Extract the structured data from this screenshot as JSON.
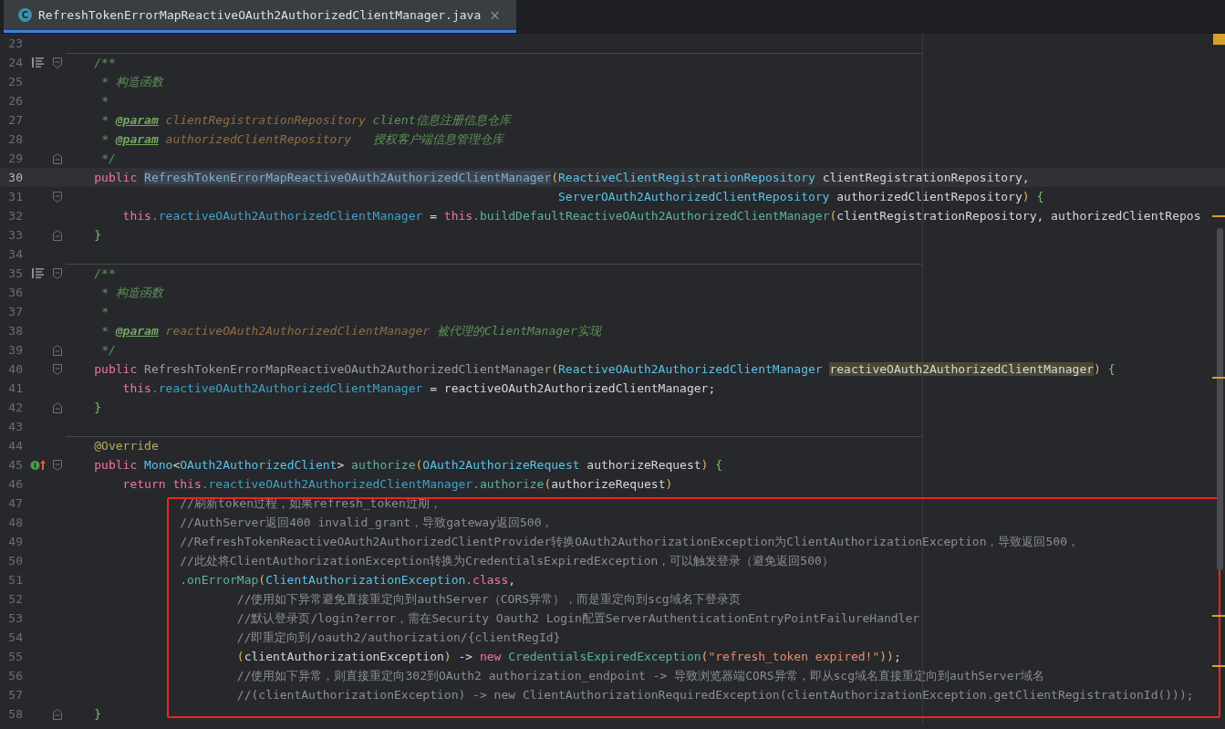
{
  "tab": {
    "icon_letter": "C",
    "title": "RefreshTokenErrorMapReactiveOAuth2AuthorizedClientManager.java",
    "close": "×"
  },
  "lines": [
    {
      "number": "23",
      "current": false,
      "method_separator": false,
      "doc_icon": false,
      "override_icon": false,
      "fold_start": false,
      "fold_end": false
    },
    {
      "number": "24",
      "current": false,
      "method_separator": true,
      "doc_icon": true,
      "override_icon": false,
      "fold_start": true,
      "fold_end": false,
      "tokens": [
        {
          "text": "    /**",
          "kind": "doc"
        }
      ]
    },
    {
      "number": "25",
      "current": false,
      "method_separator": false,
      "doc_icon": false,
      "override_icon": false,
      "fold_start": false,
      "fold_end": false,
      "tokens": [
        {
          "text": "     * 构造函数",
          "kind": "doc"
        }
      ]
    },
    {
      "number": "26",
      "current": false,
      "method_separator": false,
      "doc_icon": false,
      "override_icon": false,
      "fold_start": false,
      "fold_end": false,
      "tokens": [
        {
          "text": "     *",
          "kind": "doc"
        }
      ]
    },
    {
      "number": "27",
      "current": false,
      "method_separator": false,
      "doc_icon": false,
      "override_icon": false,
      "fold_start": false,
      "fold_end": false,
      "tokens": [
        {
          "text": "     * ",
          "kind": "doc"
        },
        {
          "text": "@param",
          "kind": "doctag"
        },
        {
          "text": " clientRegistrationRepository",
          "kind": "docparam"
        },
        {
          "text": " client信息注册信息仓库",
          "kind": "doc"
        }
      ]
    },
    {
      "number": "28",
      "current": false,
      "method_separator": false,
      "doc_icon": false,
      "override_icon": false,
      "fold_start": false,
      "fold_end": false,
      "tokens": [
        {
          "text": "     * ",
          "kind": "doc"
        },
        {
          "text": "@param",
          "kind": "doctag"
        },
        {
          "text": " authorizedClientRepository",
          "kind": "docparam"
        },
        {
          "text": "   授权客户端信息管理仓库",
          "kind": "doc"
        }
      ]
    },
    {
      "number": "29",
      "current": false,
      "method_separator": false,
      "doc_icon": false,
      "override_icon": false,
      "fold_start": false,
      "fold_end": true,
      "tokens": [
        {
          "text": "     */",
          "kind": "doc"
        }
      ]
    },
    {
      "number": "30",
      "current": true,
      "method_separator": false,
      "doc_icon": false,
      "override_icon": false,
      "fold_start": false,
      "fold_end": false,
      "tokens": [
        {
          "text": "    public ",
          "kind": "keyword"
        },
        {
          "text": "RefreshTokenErrorMapReactiveOAuth2AuthorizedClientManager",
          "kind": "selected_declaration"
        },
        {
          "text": "(",
          "kind": "bracket"
        },
        {
          "text": "ReactiveClientRegistrationRepository",
          "kind": "type"
        },
        {
          "text": " clientRegistrationRepository,",
          "kind": "plain"
        }
      ]
    },
    {
      "number": "31",
      "current": false,
      "method_separator": false,
      "doc_icon": false,
      "override_icon": false,
      "fold_start": true,
      "fold_end": false,
      "tokens": [
        {
          "text": "                                                                     ServerOAuth2AuthorizedClientRepository",
          "kind": "type"
        },
        {
          "text": " authorizedClientRepository",
          "kind": "plain"
        },
        {
          "text": ") ",
          "kind": "bracket"
        },
        {
          "text": "{",
          "kind": "brace"
        }
      ]
    },
    {
      "number": "32",
      "current": false,
      "method_separator": false,
      "doc_icon": false,
      "override_icon": false,
      "fold_start": false,
      "fold_end": false,
      "tokens": [
        {
          "text": "        this",
          "kind": "keyword"
        },
        {
          "text": ".reactiveOAuth2AuthorizedClientManager",
          "kind": "field"
        },
        {
          "text": " = ",
          "kind": "plain"
        },
        {
          "text": "this",
          "kind": "keyword"
        },
        {
          "text": ".buildDefaultReactiveOAuth2AuthorizedClientManager",
          "kind": "method"
        },
        {
          "text": "(",
          "kind": "bracket"
        },
        {
          "text": "clientRegistrationRepository, authorizedClientRepos",
          "kind": "plain"
        }
      ]
    },
    {
      "number": "33",
      "current": false,
      "method_separator": false,
      "doc_icon": false,
      "override_icon": false,
      "fold_start": false,
      "fold_end": true,
      "tokens": [
        {
          "text": "    }",
          "kind": "brace"
        }
      ]
    },
    {
      "number": "34",
      "current": false,
      "method_separator": false,
      "doc_icon": false,
      "override_icon": false,
      "fold_start": false,
      "fold_end": false
    },
    {
      "number": "35",
      "current": false,
      "method_separator": true,
      "doc_icon": true,
      "override_icon": false,
      "fold_start": true,
      "fold_end": false,
      "tokens": [
        {
          "text": "    /**",
          "kind": "doc"
        }
      ]
    },
    {
      "number": "36",
      "current": false,
      "method_separator": false,
      "doc_icon": false,
      "override_icon": false,
      "fold_start": false,
      "fold_end": false,
      "tokens": [
        {
          "text": "     * 构造函数",
          "kind": "doc"
        }
      ]
    },
    {
      "number": "37",
      "current": false,
      "method_separator": false,
      "doc_icon": false,
      "override_icon": false,
      "fold_start": false,
      "fold_end": false,
      "tokens": [
        {
          "text": "     *",
          "kind": "doc"
        }
      ]
    },
    {
      "number": "38",
      "current": false,
      "method_separator": false,
      "doc_icon": false,
      "override_icon": false,
      "fold_start": false,
      "fold_end": false,
      "tokens": [
        {
          "text": "     * ",
          "kind": "doc"
        },
        {
          "text": "@param",
          "kind": "doctag"
        },
        {
          "text": " reactiveOAuth2AuthorizedClientManager",
          "kind": "docparam"
        },
        {
          "text": " 被代理的ClientManager实现",
          "kind": "doc"
        }
      ]
    },
    {
      "number": "39",
      "current": false,
      "method_separator": false,
      "doc_icon": false,
      "override_icon": false,
      "fold_start": false,
      "fold_end": true,
      "tokens": [
        {
          "text": "     */",
          "kind": "doc"
        }
      ]
    },
    {
      "number": "40",
      "current": false,
      "method_separator": false,
      "doc_icon": false,
      "override_icon": false,
      "fold_start": true,
      "fold_end": false,
      "tokens": [
        {
          "text": "    public ",
          "kind": "keyword"
        },
        {
          "text": "RefreshTokenErrorMapReactiveOAuth2AuthorizedClientManager",
          "kind": "unused"
        },
        {
          "text": "(",
          "kind": "bracket"
        },
        {
          "text": "ReactiveOAuth2AuthorizedClientManager ",
          "kind": "type"
        },
        {
          "text": "reactiveOAuth2AuthorizedClientManager",
          "kind": "highlighted_usage"
        },
        {
          "text": ") ",
          "kind": "bracket"
        },
        {
          "text": "{",
          "kind": "brace"
        }
      ]
    },
    {
      "number": "41",
      "current": false,
      "method_separator": false,
      "doc_icon": false,
      "override_icon": false,
      "fold_start": false,
      "fold_end": false,
      "tokens": [
        {
          "text": "        this",
          "kind": "keyword"
        },
        {
          "text": ".reactiveOAuth2AuthorizedClientManager",
          "kind": "field"
        },
        {
          "text": " = reactiveOAuth2AuthorizedClientManager;",
          "kind": "plain"
        }
      ]
    },
    {
      "number": "42",
      "current": false,
      "method_separator": false,
      "doc_icon": false,
      "override_icon": false,
      "fold_start": false,
      "fold_end": true,
      "tokens": [
        {
          "text": "    }",
          "kind": "brace"
        }
      ]
    },
    {
      "number": "43",
      "current": false,
      "method_separator": false,
      "doc_icon": false,
      "override_icon": false,
      "fold_start": false,
      "fold_end": false
    },
    {
      "number": "44",
      "current": false,
      "method_separator": true,
      "doc_icon": false,
      "override_icon": false,
      "fold_start": false,
      "fold_end": false,
      "tokens": [
        {
          "text": "    @Override",
          "kind": "annotation"
        }
      ]
    },
    {
      "number": "45",
      "current": false,
      "method_separator": false,
      "doc_icon": false,
      "override_icon": true,
      "fold_start": true,
      "fold_end": false,
      "tokens": [
        {
          "text": "    public ",
          "kind": "keyword"
        },
        {
          "text": "Mono",
          "kind": "type"
        },
        {
          "text": "<",
          "kind": "plain"
        },
        {
          "text": "OAuth2AuthorizedClient",
          "kind": "type"
        },
        {
          "text": "> ",
          "kind": "plain"
        },
        {
          "text": "authorize",
          "kind": "method"
        },
        {
          "text": "(",
          "kind": "bracket"
        },
        {
          "text": "OAuth2AuthorizeRequest",
          "kind": "type"
        },
        {
          "text": " authorizeRequest",
          "kind": "plain"
        },
        {
          "text": ") ",
          "kind": "bracket"
        },
        {
          "text": "{",
          "kind": "brace"
        }
      ]
    },
    {
      "number": "46",
      "current": false,
      "method_separator": false,
      "doc_icon": false,
      "override_icon": false,
      "fold_start": false,
      "fold_end": false,
      "tokens": [
        {
          "text": "        return this",
          "kind": "keyword"
        },
        {
          "text": ".reactiveOAuth2AuthorizedClientManager",
          "kind": "field"
        },
        {
          "text": ".authorize",
          "kind": "method"
        },
        {
          "text": "(",
          "kind": "bracket"
        },
        {
          "text": "authorizeRequest",
          "kind": "plain"
        },
        {
          "text": ")",
          "kind": "bracket"
        }
      ]
    },
    {
      "number": "47",
      "current": false,
      "method_separator": false,
      "doc_icon": false,
      "override_icon": false,
      "fold_start": false,
      "fold_end": false,
      "tokens": [
        {
          "text": "                //刷新token过程，如果refresh_token过期，",
          "kind": "comment"
        }
      ]
    },
    {
      "number": "48",
      "current": false,
      "method_separator": false,
      "doc_icon": false,
      "override_icon": false,
      "fold_start": false,
      "fold_end": false,
      "tokens": [
        {
          "text": "                //AuthServer返回400 invalid_grant，导致gateway返回500，",
          "kind": "comment"
        }
      ]
    },
    {
      "number": "49",
      "current": false,
      "method_separator": false,
      "doc_icon": false,
      "override_icon": false,
      "fold_start": false,
      "fold_end": false,
      "tokens": [
        {
          "text": "                //RefreshTokenReactiveOAuth2AuthorizedClientProvider转换OAuth2AuthorizationException为ClientAuthorizationException，导致返回500，",
          "kind": "comment"
        }
      ]
    },
    {
      "number": "50",
      "current": false,
      "method_separator": false,
      "doc_icon": false,
      "override_icon": false,
      "fold_start": false,
      "fold_end": false,
      "tokens": [
        {
          "text": "                //此处将ClientAuthorizationException转换为CredentialsExpiredException，可以触发登录（避免返回500）",
          "kind": "comment"
        }
      ]
    },
    {
      "number": "51",
      "current": false,
      "method_separator": false,
      "doc_icon": false,
      "override_icon": false,
      "fold_start": false,
      "fold_end": false,
      "tokens": [
        {
          "text": "                .onErrorMap",
          "kind": "method"
        },
        {
          "text": "(",
          "kind": "bracket"
        },
        {
          "text": "ClientAuthorizationException",
          "kind": "type"
        },
        {
          "text": ".class",
          "kind": "keyword"
        },
        {
          "text": ",",
          "kind": "plain"
        }
      ]
    },
    {
      "number": "52",
      "current": false,
      "method_separator": false,
      "doc_icon": false,
      "override_icon": false,
      "fold_start": false,
      "fold_end": false,
      "tokens": [
        {
          "text": "                        //使用如下异常避免直接重定向到authServer（CORS异常），而是重定向到scg域名下登录页",
          "kind": "comment"
        }
      ]
    },
    {
      "number": "53",
      "current": false,
      "method_separator": false,
      "doc_icon": false,
      "override_icon": false,
      "fold_start": false,
      "fold_end": false,
      "tokens": [
        {
          "text": "                        //默认登录页/login?error，需在Security Oauth2 Login配置ServerAuthenticationEntryPointFailureHandler",
          "kind": "comment"
        }
      ]
    },
    {
      "number": "54",
      "current": false,
      "method_separator": false,
      "doc_icon": false,
      "override_icon": false,
      "fold_start": false,
      "fold_end": false,
      "tokens": [
        {
          "text": "                        //即重定向到/oauth2/authorization/{clientRegId}",
          "kind": "comment"
        }
      ]
    },
    {
      "number": "55",
      "current": false,
      "method_separator": false,
      "doc_icon": false,
      "override_icon": false,
      "fold_start": false,
      "fold_end": false,
      "tokens": [
        {
          "text": "                        (",
          "kind": "bracket"
        },
        {
          "text": "clientAuthorizationException",
          "kind": "plain"
        },
        {
          "text": ")",
          "kind": "bracket"
        },
        {
          "text": " -> ",
          "kind": "plain"
        },
        {
          "text": "new ",
          "kind": "keyword"
        },
        {
          "text": "CredentialsExpiredException",
          "kind": "method"
        },
        {
          "text": "(",
          "kind": "bracket"
        },
        {
          "text": "\"refresh_token expired!\"",
          "kind": "string"
        },
        {
          "text": "))",
          "kind": "bracket"
        },
        {
          "text": ";",
          "kind": "plain"
        }
      ]
    },
    {
      "number": "56",
      "current": false,
      "method_separator": false,
      "doc_icon": false,
      "override_icon": false,
      "fold_start": false,
      "fold_end": false,
      "tokens": [
        {
          "text": "                        //使用如下异常，则直接重定向302到OAuth2 authorization_endpoint -> 导致浏览器端CORS异常，即从scg域名直接重定向到authServer域名",
          "kind": "comment"
        }
      ]
    },
    {
      "number": "57",
      "current": false,
      "method_separator": false,
      "doc_icon": false,
      "override_icon": false,
      "fold_start": false,
      "fold_end": false,
      "tokens": [
        {
          "text": "                        //(clientAuthorizationException) -> new ClientAuthorizationRequiredException(clientAuthorizationException.getClientRegistrationId()));",
          "kind": "comment"
        }
      ]
    },
    {
      "number": "58",
      "current": false,
      "method_separator": false,
      "doc_icon": false,
      "override_icon": false,
      "fold_start": false,
      "fold_end": true,
      "tokens": [
        {
          "text": "    }",
          "kind": "brace"
        }
      ]
    }
  ]
}
